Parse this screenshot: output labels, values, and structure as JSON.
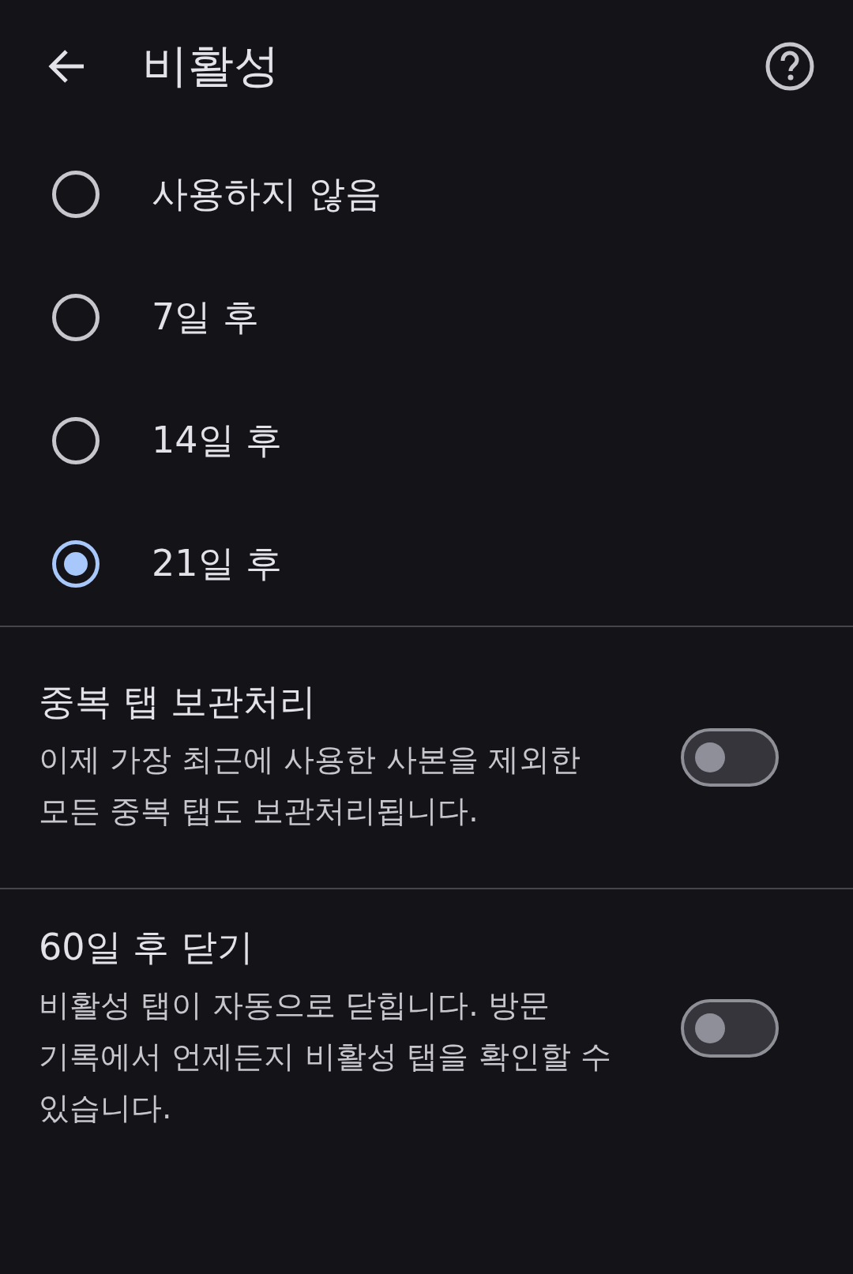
{
  "header": {
    "title": "비활성"
  },
  "options": [
    {
      "label": "사용하지 않음",
      "selected": false
    },
    {
      "label": "7일 후",
      "selected": false
    },
    {
      "label": "14일 후",
      "selected": false
    },
    {
      "label": "21일 후",
      "selected": true
    }
  ],
  "settings": [
    {
      "title": "중복 탭 보관처리",
      "description": "이제 가장 최근에 사용한 사본을 제외한 모든 중복 탭도 보관처리됩니다.",
      "on": false
    },
    {
      "title": "60일 후 닫기",
      "description": "비활성 탭이 자동으로 닫힙니다. 방문 기록에서 언제든지 비활성 탭을 확인할 수 있습니다.",
      "on": false
    }
  ]
}
